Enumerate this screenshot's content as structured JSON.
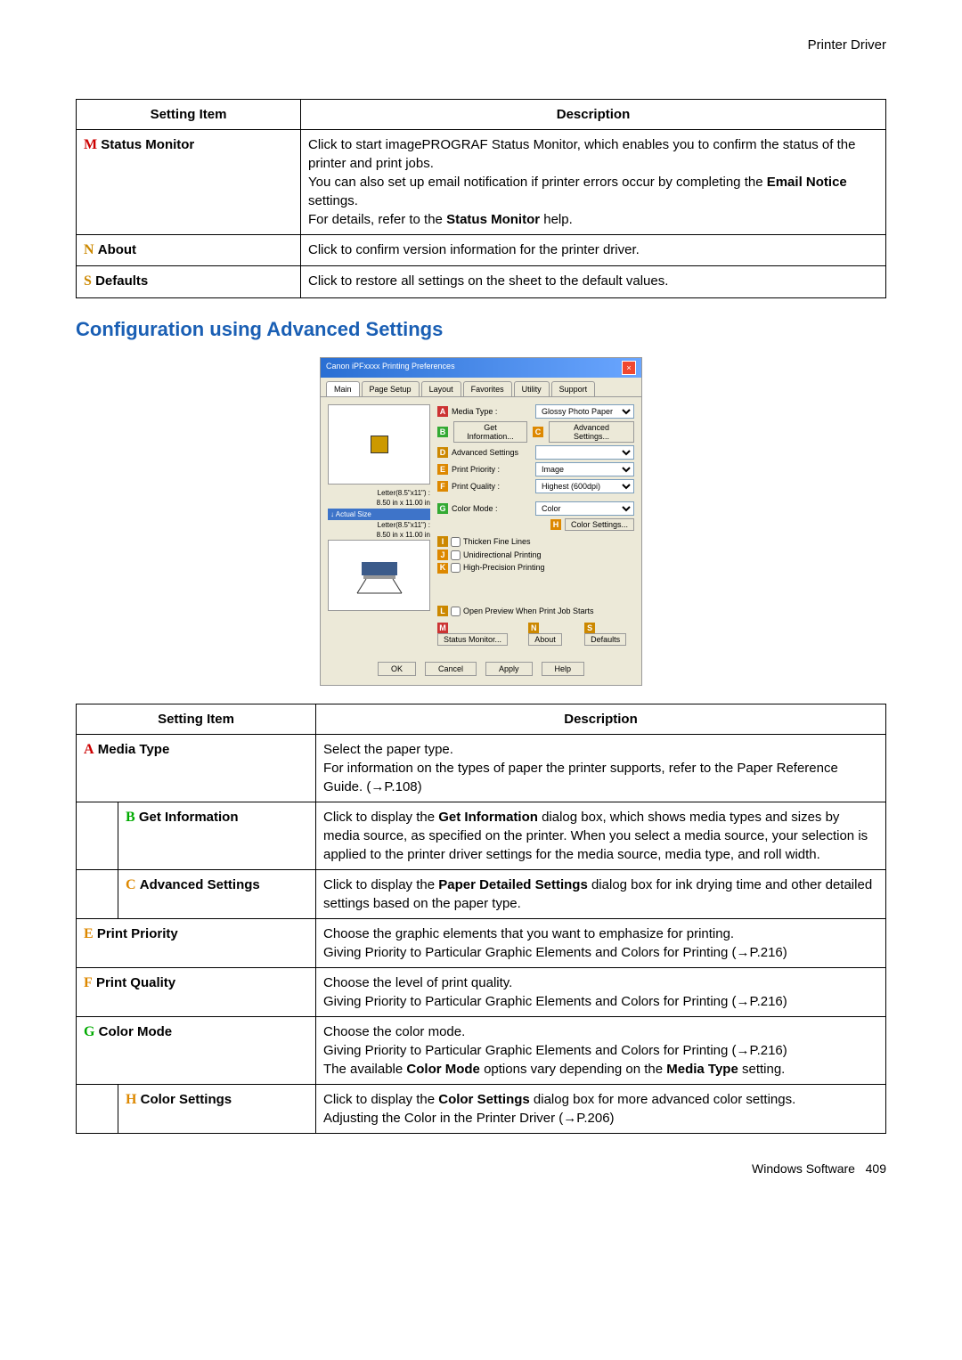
{
  "header": {
    "breadcrumb": "Printer Driver"
  },
  "table1": {
    "headers": {
      "col1": "Setting Item",
      "col2": "Description"
    },
    "rows": [
      {
        "letter": "M",
        "name": "Status Monitor",
        "desc_html": "Click to start imagePROGRAF Status Monitor, which enables you to confirm the status of the printer and print jobs.\nYou can also set up email notification if printer errors occur by completing the <b>Email Notice</b> settings.\nFor details, refer to the <b>Status Monitor</b> help."
      },
      {
        "letter": "N",
        "name": "About",
        "desc_html": "Click to confirm version information for the printer driver."
      },
      {
        "letter": "S",
        "name": "Defaults",
        "desc_html": "Click to restore all settings on the sheet to the default values."
      }
    ]
  },
  "section_title": "Configuration using Advanced Settings",
  "screenshot": {
    "title": "Canon iPFxxxx Printing Preferences",
    "tabs": [
      "Main",
      "Page Setup",
      "Layout",
      "Favorites",
      "Utility",
      "Support"
    ],
    "media_type_label": "Media Type :",
    "media_type_value": "Glossy Photo Paper",
    "get_info": "Get Information...",
    "adv_settings_btn": "Advanced Settings...",
    "adv_settings_label": "Advanced Settings",
    "print_priority_label": "Print Priority :",
    "print_priority_value": "Image",
    "print_quality_label": "Print Quality :",
    "print_quality_value": "Highest (600dpi)",
    "color_mode_label": "Color Mode :",
    "color_mode_value": "Color",
    "color_settings_btn": "Color Settings...",
    "paper1": "Letter(8.5\"x11\") :",
    "paper1_size": "8.50 in x 11.00 in",
    "actual": "Actual Size",
    "paper2": "Letter(8.5\"x11\") :",
    "paper2_size": "8.50 in x 11.00 in",
    "check1": "Thicken Fine Lines",
    "check2": "Unidirectional Printing",
    "check3": "High-Precision Printing",
    "open_preview": "Open Preview When Print Job Starts",
    "status_monitor": "Status Monitor...",
    "about": "About",
    "defaults": "Defaults",
    "ok": "OK",
    "cancel": "Cancel",
    "apply": "Apply",
    "help": "Help"
  },
  "table2": {
    "headers": {
      "col1": "Setting Item",
      "col2": "Description"
    },
    "rows": [
      {
        "letter": "A",
        "name": "Media Type",
        "indent": false,
        "desc_html": "Select the paper type.\nFor information on the types of paper the printer supports, refer to the Paper Reference Guide. (→P.108)"
      },
      {
        "letter": "B",
        "name": "Get Information",
        "indent": true,
        "desc_html": "Click to display the <b>Get Information</b> dialog box, which shows media types and sizes by media source, as specified on the printer. When you select a media source, your selection is applied to the printer driver settings for the media source, media type, and roll width."
      },
      {
        "letter": "C",
        "name": "Advanced Settings",
        "indent": true,
        "desc_html": "Click to display the <b>Paper Detailed Settings</b> dialog box for ink drying time and other detailed settings based on the paper type."
      },
      {
        "letter": "E",
        "name": "Print Priority",
        "indent": false,
        "desc_html": "Choose the graphic elements that you want to emphasize for printing.\nGiving Priority to Particular Graphic Elements and Colors for Printing (→P.216)"
      },
      {
        "letter": "F",
        "name": "Print Quality",
        "indent": false,
        "desc_html": "Choose the level of print quality.\nGiving Priority to Particular Graphic Elements and Colors for Printing (→P.216)"
      },
      {
        "letter": "G",
        "name": "Color Mode",
        "indent": false,
        "desc_html": "Choose the color mode.\nGiving Priority to Particular Graphic Elements and Colors for Printing (→P.216)\nThe available <b>Color Mode</b> options vary depending on the <b>Media Type</b> setting."
      },
      {
        "letter": "H",
        "name": "Color Settings",
        "indent": true,
        "desc_html": "Click to display the <b>Color Settings</b> dialog box for more advanced color settings.\nAdjusting the Color in the Printer Driver (→P.206)"
      }
    ]
  },
  "footer": {
    "text": "Windows Software",
    "page": "409"
  }
}
